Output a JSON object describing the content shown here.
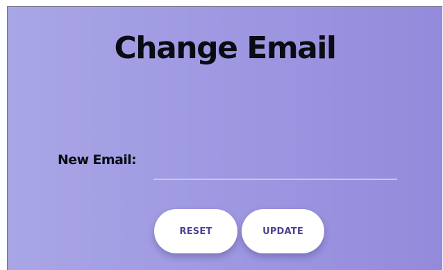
{
  "page": {
    "title": "Change Email"
  },
  "form": {
    "email_label": "New Email:",
    "email_value": "",
    "email_placeholder": ""
  },
  "buttons": {
    "reset_label": "RESET",
    "update_label": "UPDATE"
  },
  "colors": {
    "background_gradient_start": "#a9a6e6",
    "background_gradient_end": "#948adb",
    "button_text": "#4b4296",
    "button_background": "#ffffff",
    "input_underline": "#c9c7ee"
  }
}
